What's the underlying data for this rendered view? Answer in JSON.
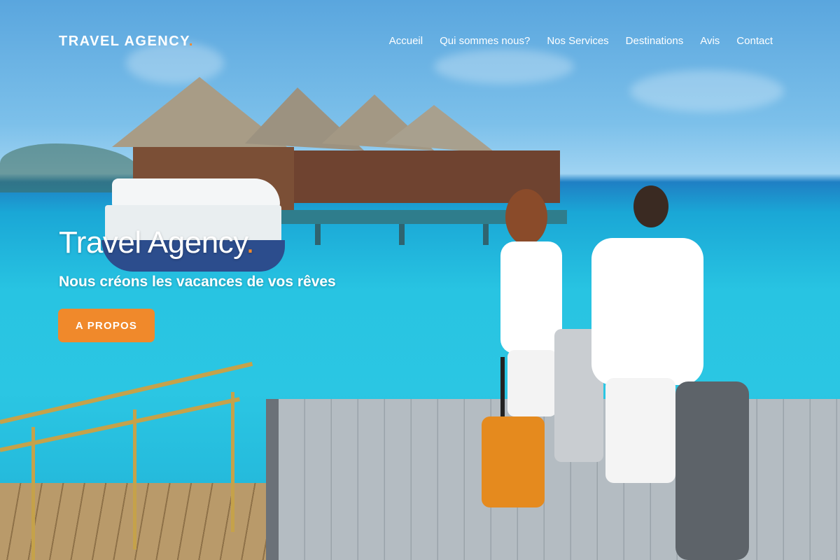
{
  "brand": {
    "name": "TRAVEL AGENCY",
    "dot": "."
  },
  "nav": {
    "items": [
      {
        "label": "Accueil"
      },
      {
        "label": "Qui sommes nous?"
      },
      {
        "label": "Nos Services"
      },
      {
        "label": "Destinations"
      },
      {
        "label": "Avis"
      },
      {
        "label": "Contact"
      }
    ]
  },
  "hero": {
    "title": "Travel Agency",
    "title_dot": ".",
    "subtitle": "Nous créons les vacances de vos rêves",
    "button_label": "A PROPOS",
    "image": "tropical-pier-couple-with-suitcases"
  },
  "colors": {
    "accent": "#f0892b",
    "text": "#ffffff"
  }
}
